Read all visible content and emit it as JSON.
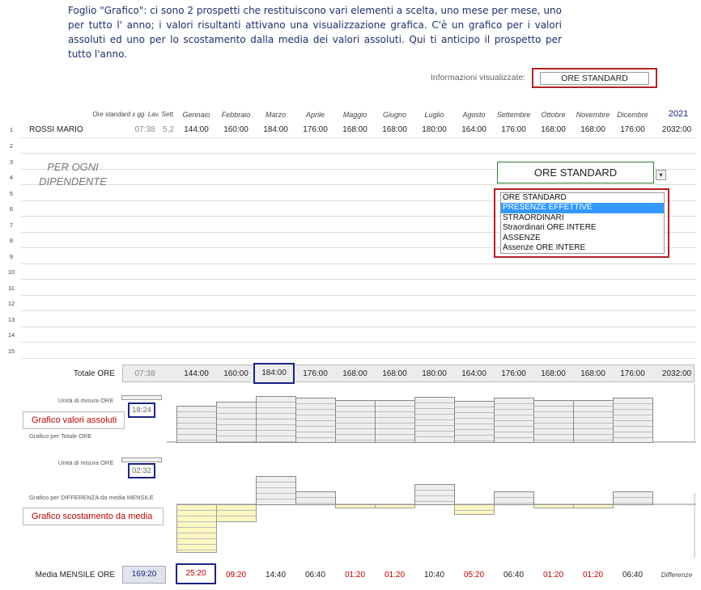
{
  "intro": {
    "keyword": "Foglio \"Grafico\"",
    "text": ": ci sono 2 prospetti che restituiscono vari elementi a scelta, uno mese per mese, uno per tutto l' anno; i valori risultanti attivano una visualizzazione grafica. C'è un grafico per i valori assoluti ed uno per lo scostamento dalla media dei valori assoluti. Qui ti anticipo il prospetto per tutto l'anno."
  },
  "info": {
    "label": "Informazioni visualizzate:",
    "value": "ORE STANDARD"
  },
  "header": {
    "ore_label": "Ore standard x gg. Lav. Sett.",
    "months": [
      "Gennaio",
      "Febbraio",
      "Marzo",
      "Aprile",
      "Maggio",
      "Giugno",
      "Luglio",
      "Agosto",
      "Settembre",
      "Ottobre",
      "Novembre",
      "Dicembre"
    ],
    "year": "2021"
  },
  "employee": {
    "row": "1",
    "name": "ROSSI MARIO",
    "ore": "07:38",
    "gg": "5,2",
    "monthly": [
      "144:00",
      "160:00",
      "184:00",
      "176:00",
      "168:00",
      "168:00",
      "180:00",
      "164:00",
      "176:00",
      "168:00",
      "168:00",
      "176:00"
    ],
    "total": "2032:00"
  },
  "row_numbers": [
    "2",
    "3",
    "4",
    "5",
    "6",
    "7",
    "8",
    "9",
    "10",
    "11",
    "12",
    "13",
    "14",
    "15"
  ],
  "per_ogni": [
    "PER OGNI",
    "DIPENDENTE"
  ],
  "combo": {
    "value": "ORE STANDARD",
    "arrow": "▾",
    "options": [
      "ORE STANDARD",
      "PRESENZE EFFETTIVE",
      "STRAORDINARI",
      "Straordinari ORE INTERE",
      "ASSENZE",
      "Assenze ORE INTERE"
    ],
    "highlighted_index": 1
  },
  "totale": {
    "label": "Totale ORE",
    "ore": "07:38",
    "monthly": [
      "144:00",
      "160:00",
      "184:00",
      "176:00",
      "168:00",
      "168:00",
      "180:00",
      "164:00",
      "176:00",
      "168:00",
      "168:00",
      "176:00"
    ],
    "total": "2032:00",
    "highlight_index": 2
  },
  "chart_abs": {
    "unit_label": "Unità di misura ORE",
    "unit_value": "18:24",
    "button_label": "Grafico valori assoluti",
    "caption": "Grafico per Totale ORE"
  },
  "chart_dev": {
    "unit_label": "Unità di misura ORE",
    "unit_value": "02:32",
    "caption": "Grafico per DIFFERENZA da media MENSILE",
    "button_label": "Grafico scostamento da media"
  },
  "chart_data": [
    {
      "type": "bar",
      "categories": [
        "Gennaio",
        "Febbraio",
        "Marzo",
        "Aprile",
        "Maggio",
        "Giugno",
        "Luglio",
        "Agosto",
        "Settembre",
        "Ottobre",
        "Novembre",
        "Dicembre"
      ],
      "values": [
        144,
        160,
        184,
        176,
        168,
        168,
        180,
        164,
        176,
        168,
        168,
        176
      ],
      "unit": "ORE",
      "ylim": [
        0,
        184
      ]
    },
    {
      "type": "bar",
      "categories": [
        "Gennaio",
        "Febbraio",
        "Marzo",
        "Aprile",
        "Maggio",
        "Giugno",
        "Luglio",
        "Agosto",
        "Settembre",
        "Ottobre",
        "Novembre",
        "Dicembre"
      ],
      "values": [
        -25.33,
        -9.33,
        14.67,
        6.67,
        -1.33,
        -1.33,
        10.67,
        -5.33,
        6.67,
        -1.33,
        -1.33,
        6.67
      ],
      "unit": "ORE",
      "ylim": [
        -25.33,
        14.67
      ]
    }
  ],
  "media": {
    "label": "Media MENSILE ORE",
    "value": "169:20",
    "diffs": [
      "25:20",
      "09:20",
      "14:40",
      "06:40",
      "01:20",
      "01:20",
      "10:40",
      "05:20",
      "06:40",
      "01:20",
      "01:20",
      "06:40"
    ],
    "negative": [
      true,
      true,
      false,
      false,
      true,
      true,
      false,
      true,
      false,
      true,
      true,
      false
    ],
    "suffix": "Differenze",
    "highlight_index": 0
  },
  "colors": {
    "negative": "#c00000",
    "positive": "#222222",
    "red_frame": "#b22222",
    "blue_frame": "#1a237e",
    "combo_border": "#2e7d32",
    "highlight": "#3399ff"
  }
}
